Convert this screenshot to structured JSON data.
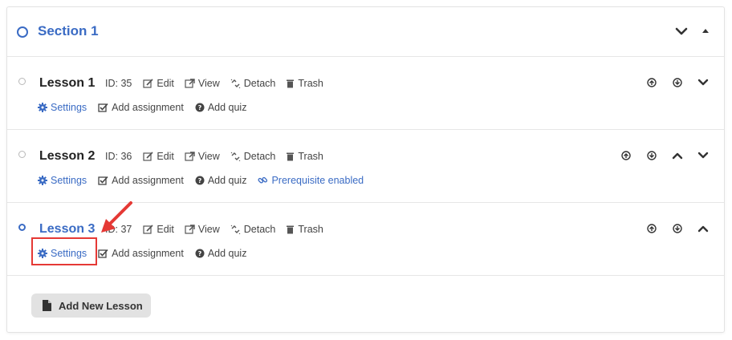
{
  "section": {
    "title": "Section 1"
  },
  "lessons": [
    {
      "title": "Lesson 1",
      "id_text": "ID: 35",
      "actions": [
        "Edit",
        "View",
        "Detach",
        "Trash"
      ],
      "links": [
        "Settings",
        "Add assignment",
        "Add quiz"
      ]
    },
    {
      "title": "Lesson 2",
      "id_text": "ID: 36",
      "actions": [
        "Edit",
        "View",
        "Detach",
        "Trash"
      ],
      "links": [
        "Settings",
        "Add assignment",
        "Add quiz",
        "Prerequisite enabled"
      ]
    },
    {
      "title": "Lesson 3",
      "id_text": "ID: 37",
      "actions": [
        "Edit",
        "View",
        "Detach",
        "Trash"
      ],
      "links": [
        "Settings",
        "Add assignment",
        "Add quiz"
      ]
    }
  ],
  "footer": {
    "add_lesson_label": "Add New Lesson"
  },
  "colors": {
    "accent": "#3a6bc4",
    "highlight": "#e53935"
  }
}
